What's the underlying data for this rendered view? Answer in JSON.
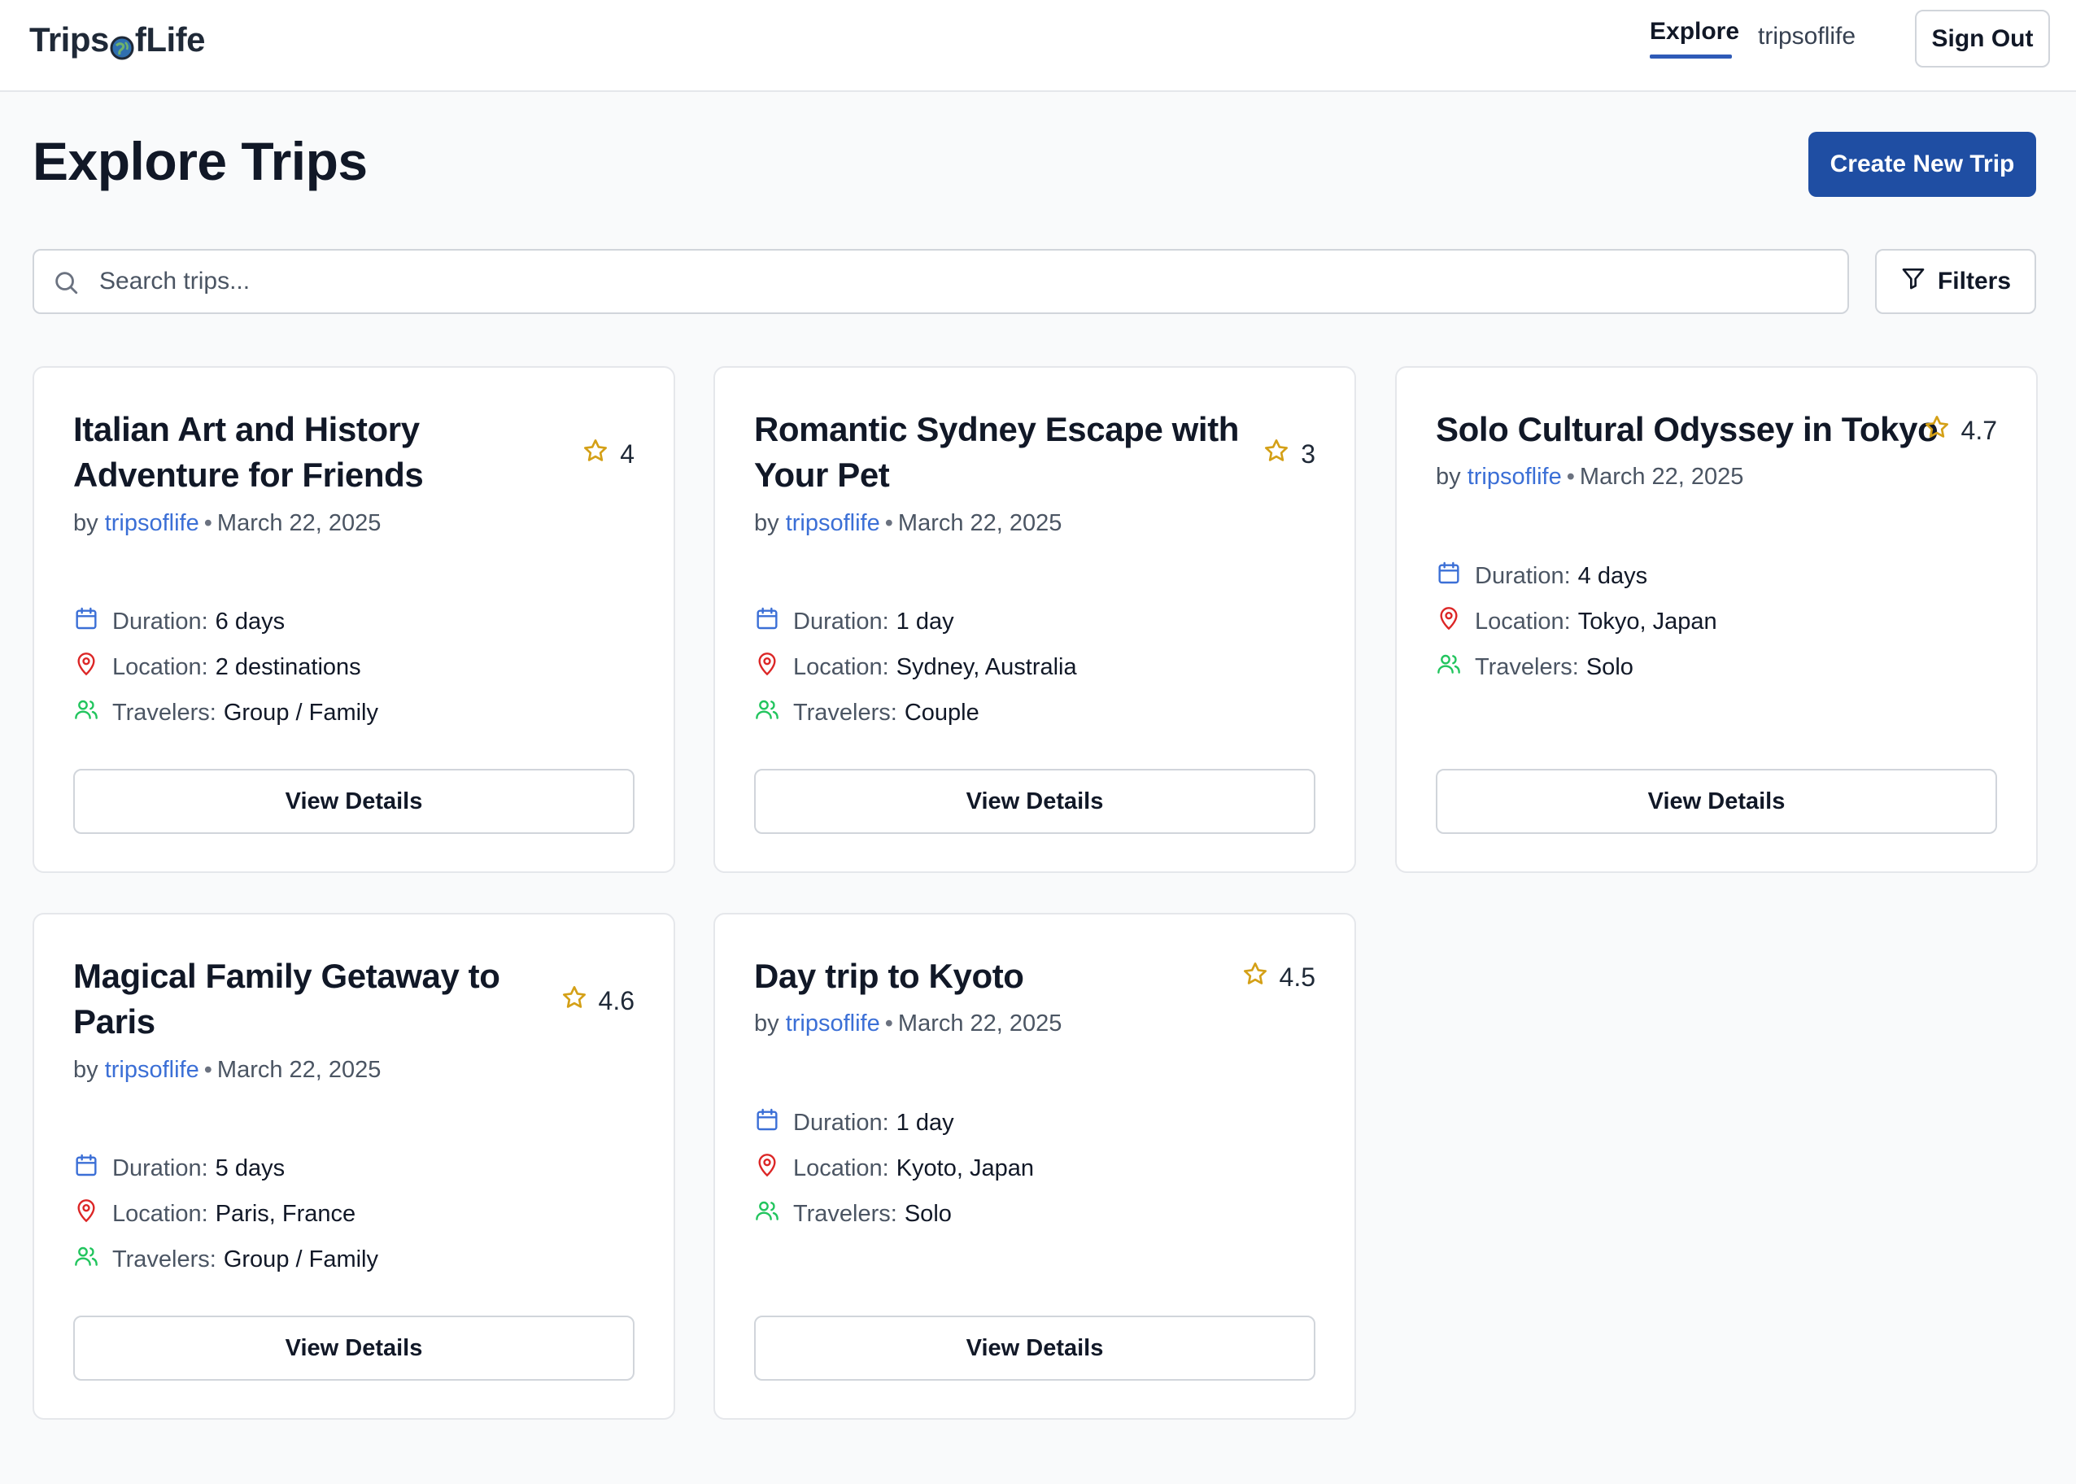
{
  "header": {
    "logo_pre": "Trips",
    "logo_post": "fLife",
    "nav_explore": "Explore",
    "nav_user": "tripsoflife",
    "signout_label": "Sign Out"
  },
  "page": {
    "title": "Explore Trips",
    "create_label": "Create New Trip"
  },
  "search": {
    "placeholder": "Search trips...",
    "filters_label": "Filters"
  },
  "labels": {
    "by": "by",
    "duration": "Duration:",
    "location": "Location:",
    "travelers": "Travelers:",
    "view_details": "View Details"
  },
  "colors": {
    "accent": "#1f4ea3",
    "link": "#3b6fd6",
    "star": "#d4a017",
    "calendar": "#3b6fd6",
    "pin": "#dc2626",
    "users": "#22c55e"
  },
  "trips": [
    {
      "title": "Italian Art and History Adventure for Friends",
      "rating": "4",
      "author": "tripsoflife",
      "date": "March 22, 2025",
      "duration": "6 days",
      "location": "2 destinations",
      "travelers": "Group / Family"
    },
    {
      "title": "Romantic Sydney Escape with Your Pet",
      "rating": "3",
      "author": "tripsoflife",
      "date": "March 22, 2025",
      "duration": "1 day",
      "location": "Sydney, Australia",
      "travelers": "Couple"
    },
    {
      "title": "Solo Cultural Odyssey in Tokyo",
      "rating": "4.7",
      "author": "tripsoflife",
      "date": "March 22, 2025",
      "duration": "4 days",
      "location": "Tokyo, Japan",
      "travelers": "Solo"
    },
    {
      "title": "Magical Family Getaway to Paris",
      "rating": "4.6",
      "author": "tripsoflife",
      "date": "March 22, 2025",
      "duration": "5 days",
      "location": "Paris, France",
      "travelers": "Group / Family"
    },
    {
      "title": "Day trip to Kyoto",
      "rating": "4.5",
      "author": "tripsoflife",
      "date": "March 22, 2025",
      "duration": "1 day",
      "location": "Kyoto, Japan",
      "travelers": "Solo"
    }
  ]
}
